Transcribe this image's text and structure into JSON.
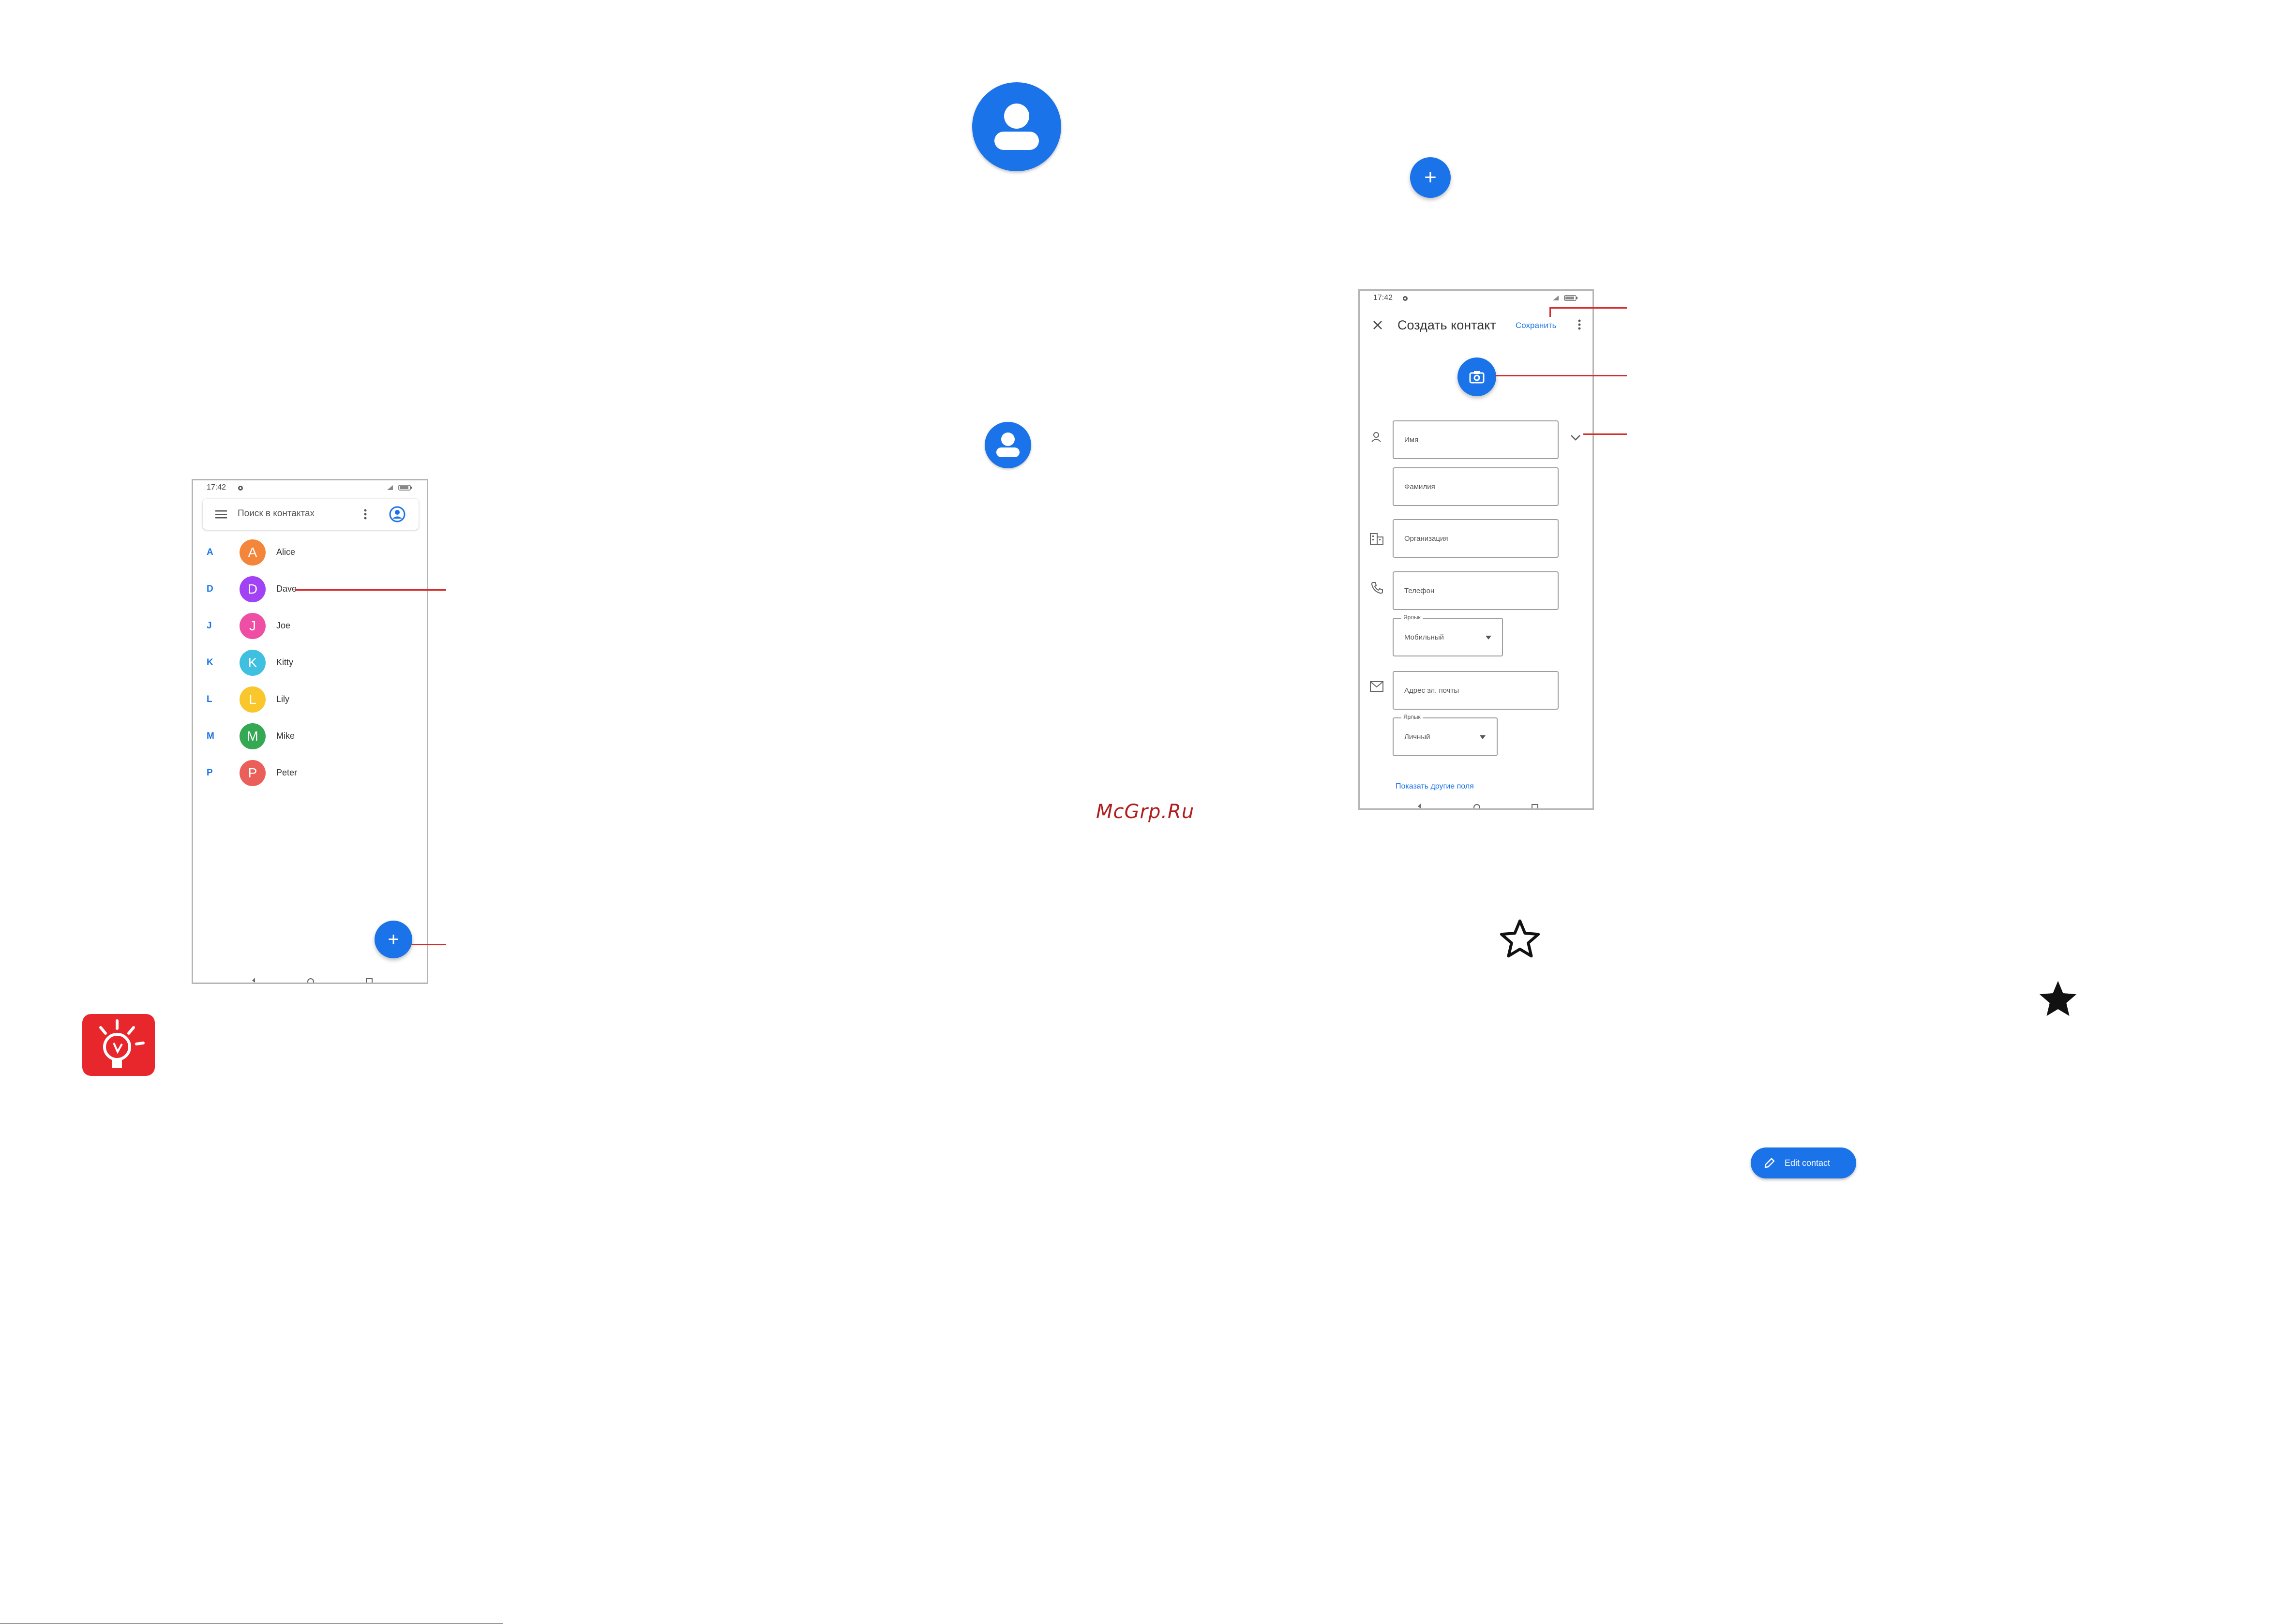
{
  "phone1": {
    "time": "17:42",
    "search_placeholder": "Поиск в контактах",
    "contacts": [
      {
        "letter": "A",
        "initial": "A",
        "name": "Alice",
        "color": "#f4863b"
      },
      {
        "letter": "D",
        "initial": "D",
        "name": "Dave",
        "color": "#a142f4"
      },
      {
        "letter": "J",
        "initial": "J",
        "name": "Joe",
        "color": "#ee4fa5"
      },
      {
        "letter": "K",
        "initial": "K",
        "name": "Kitty",
        "color": "#3fc0e0"
      },
      {
        "letter": "L",
        "initial": "L",
        "name": "Lily",
        "color": "#f9c72b"
      },
      {
        "letter": "M",
        "initial": "M",
        "name": "Mike",
        "color": "#34a853"
      },
      {
        "letter": "P",
        "initial": "P",
        "name": "Peter",
        "color": "#ea5f5a"
      }
    ],
    "fab_label": "+"
  },
  "phone2": {
    "time": "17:42",
    "title": "Создать контакт",
    "save_label": "Сохранить",
    "fields": {
      "first_name": "Имя",
      "last_name": "Фамилия",
      "company": "Организация",
      "phone": "Телефон",
      "phone_label_caption": "Ярлык",
      "phone_label_value": "Мобильный",
      "email": "Адрес эл. почты",
      "email_label_caption": "Ярлык",
      "email_label_value": "Личный"
    },
    "more_fields_link": "Показать другие поля"
  },
  "add_icon_label": "+",
  "watermark": "McGrp.Ru",
  "edit_contact_button": "Edit contact",
  "colors": {
    "accent": "#1a73e8",
    "callout": "#d32f2f",
    "tip_badge": "#e8272d"
  }
}
